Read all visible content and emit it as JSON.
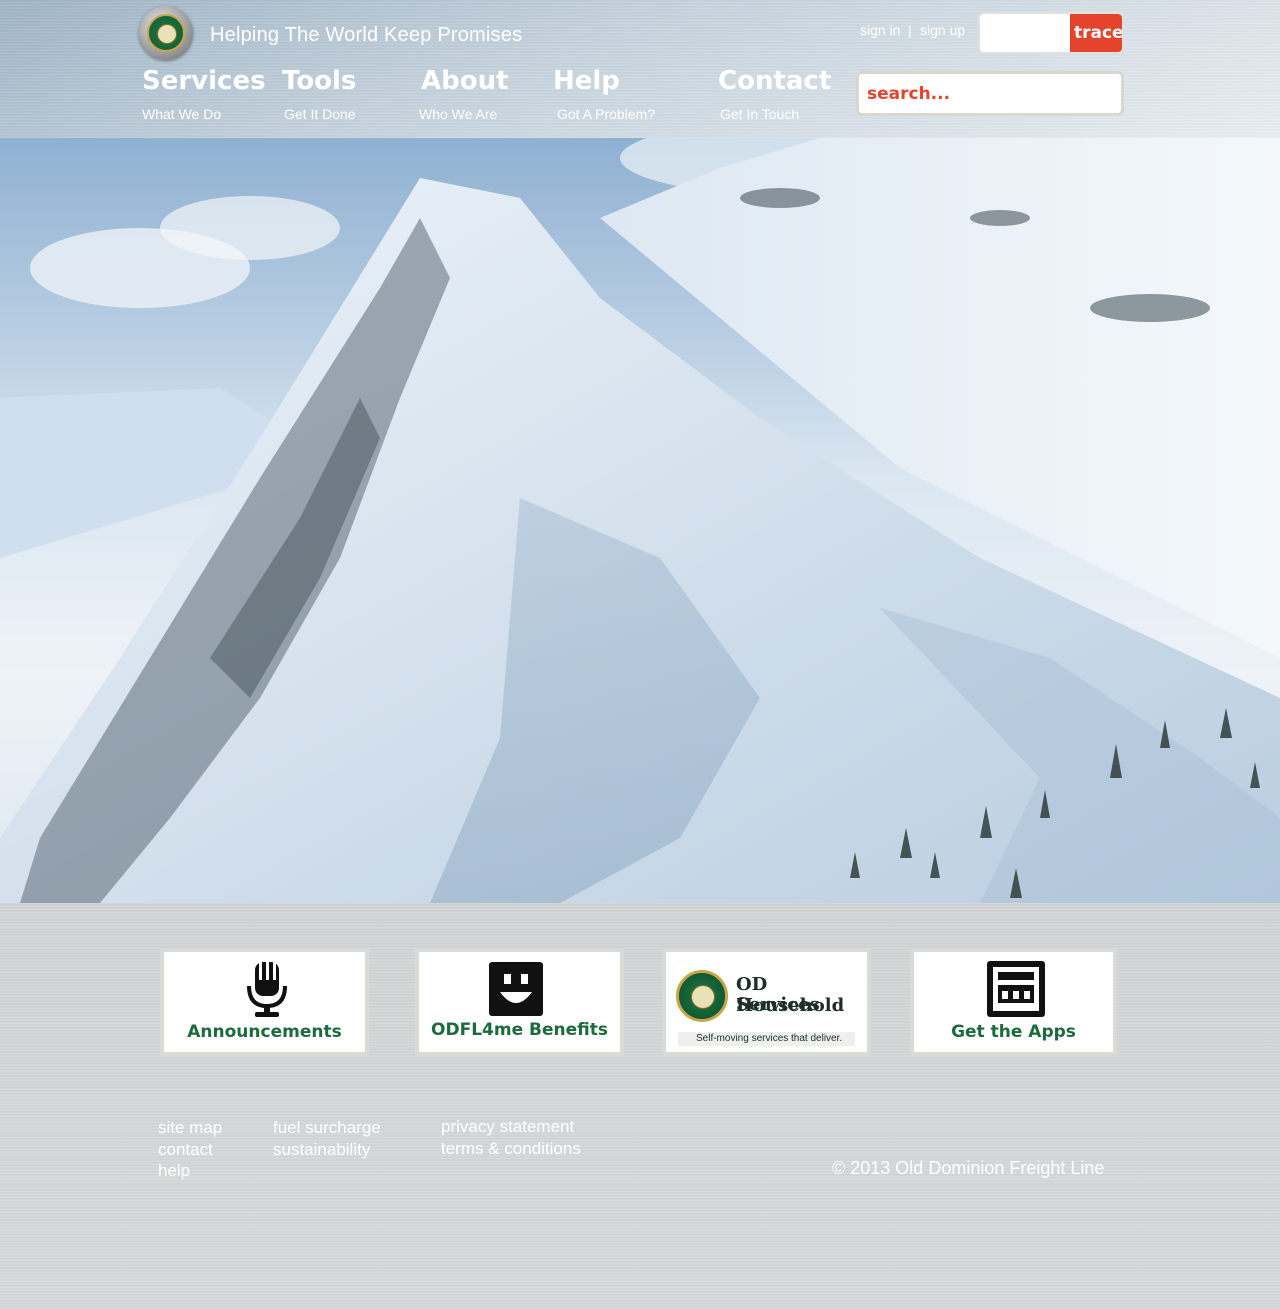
{
  "header": {
    "tagline": "Helping The World Keep Promises",
    "sign_in": "sign in",
    "separator": "|",
    "sign_up": "sign up",
    "trace_button": "trace",
    "search_placeholder": "search..."
  },
  "nav": [
    {
      "label": "Services",
      "sub": "What We Do"
    },
    {
      "label": "Tools",
      "sub": "Get It Done"
    },
    {
      "label": "About",
      "sub": "Who We Are"
    },
    {
      "label": "Help",
      "sub": "Got A Problem?"
    },
    {
      "label": "Contact",
      "sub": "Get In Touch"
    }
  ],
  "cards": [
    {
      "label": "Announcements",
      "icon": "microphone-icon"
    },
    {
      "label": "ODFL4me Benefits",
      "icon": "smiley-icon"
    },
    {
      "title_line1": "OD Household",
      "title_line2": "Services",
      "tagline": "Self-moving services that deliver.",
      "icon": "od-logo-icon"
    },
    {
      "label": "Get the Apps",
      "icon": "app-window-icon"
    }
  ],
  "footer": {
    "col1": [
      "site map",
      "contact",
      "help"
    ],
    "col2": [
      "fuel surcharge",
      "sustainability"
    ],
    "col3": [
      "privacy statement",
      "terms & conditions"
    ],
    "copyright": "©  2013 Old Dominion Freight Line"
  },
  "colors": {
    "accent_red": "#e4442c",
    "brand_green": "#1c6b3c"
  }
}
